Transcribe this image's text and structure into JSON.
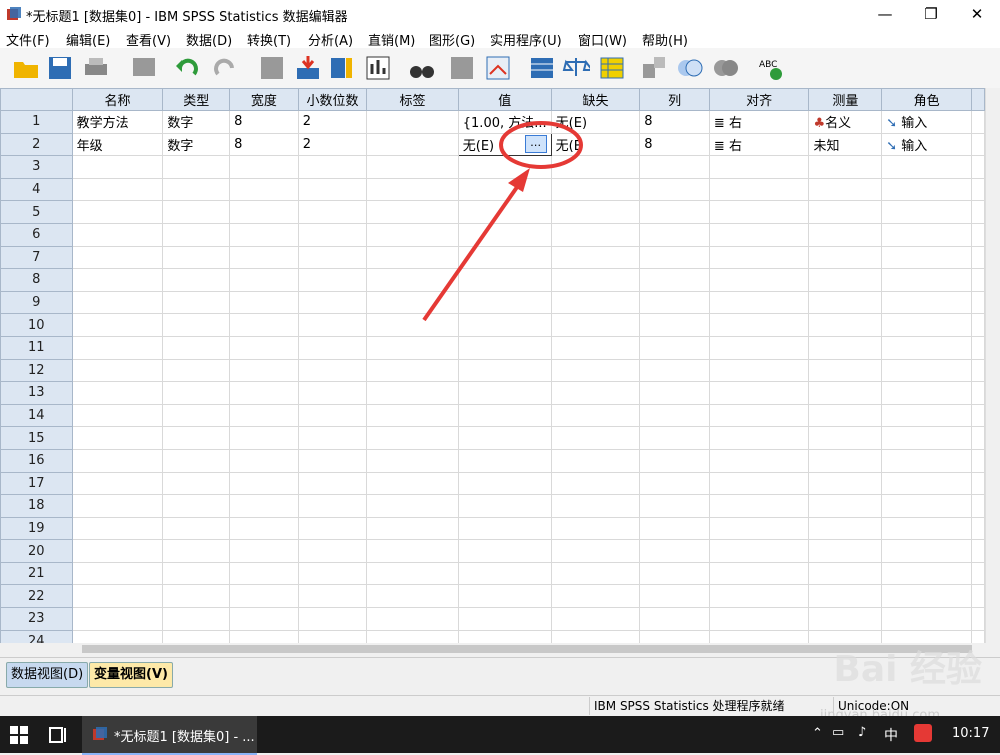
{
  "window": {
    "title": "*无标题1 [数据集0] - IBM SPSS Statistics 数据编辑器",
    "controls": [
      "—",
      "❐",
      "✕"
    ]
  },
  "menu": [
    "文件(F)",
    "编辑(E)",
    "查看(V)",
    "数据(D)",
    "转换(T)",
    "分析(A)",
    "直销(M)",
    "图形(G)",
    "实用程序(U)",
    "窗口(W)",
    "帮助(H)"
  ],
  "columns": [
    "名称",
    "类型",
    "宽度",
    "小数位数",
    "标签",
    "值",
    "缺失",
    "列",
    "对齐",
    "测量",
    "角色"
  ],
  "rows": [
    {
      "num": "1",
      "name": "教学方法",
      "type": "数字",
      "width": "8",
      "decimals": "2",
      "label": "",
      "values": "{1.00, 方法...",
      "missing": "无(E)",
      "columns": "8",
      "align": "右",
      "measure": "名义",
      "role": "输入"
    },
    {
      "num": "2",
      "name": "年级",
      "type": "数字",
      "width": "8",
      "decimals": "2",
      "label": "",
      "values": "无(E)",
      "missing": "无(E",
      "columns": "8",
      "align": "右",
      "measure": "未知",
      "role": "输入"
    }
  ],
  "empty_rows": [
    "3",
    "4",
    "5",
    "6",
    "7",
    "8",
    "9",
    "10",
    "11",
    "12",
    "13",
    "14",
    "15",
    "16",
    "17",
    "18",
    "19",
    "20",
    "21",
    "22",
    "23",
    "24"
  ],
  "tabs": {
    "data_view": "数据视图(D)",
    "variable_view": "变量视图(V)"
  },
  "status": {
    "processor": "IBM SPSS Statistics 处理程序就绪",
    "unicode": "Unicode:ON"
  },
  "taskbar": {
    "task_title": "*无标题1 [数据集0] - ...",
    "ime": "中",
    "clock": "10:17"
  },
  "watermark": {
    "brand": "Bai 经验",
    "url": "jingyan.baidu.com"
  },
  "colors": {
    "header": "#dce6f2",
    "highlight": "#e53935",
    "active_tab": "#fde9a8"
  }
}
